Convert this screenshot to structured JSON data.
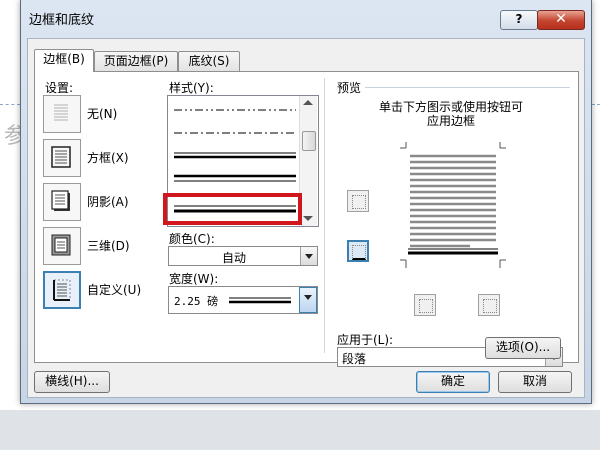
{
  "window": {
    "title": "边框和底纹",
    "help_label": "?",
    "close_label": "✕"
  },
  "tabs": [
    {
      "label": "边框(B)",
      "active": true
    },
    {
      "label": "页面边框(P)",
      "active": false
    },
    {
      "label": "底纹(S)",
      "active": false
    }
  ],
  "setting": {
    "label": "设置:",
    "presets": [
      {
        "label": "无(N)",
        "icon": "border-none-icon"
      },
      {
        "label": "方框(X)",
        "icon": "border-box-icon"
      },
      {
        "label": "阴影(A)",
        "icon": "border-shadow-icon"
      },
      {
        "label": "三维(D)",
        "icon": "border-3d-icon"
      },
      {
        "label": "自定义(U)",
        "icon": "border-custom-icon",
        "selected": true
      }
    ]
  },
  "style": {
    "label": "样式(Y):",
    "items": [
      "dash-dot-dot",
      "dash-dot",
      "thin-thick",
      "thick-thin",
      "double-thick"
    ],
    "selected_index": 4
  },
  "color": {
    "label": "颜色(C):",
    "value": "自动"
  },
  "width": {
    "label": "宽度(W):",
    "value": "2.25 磅"
  },
  "preview": {
    "label": "预览",
    "hint_line1": "单击下方图示或使用按钮可",
    "hint_line2": "应用边框"
  },
  "apply_to": {
    "label": "应用于(L):",
    "value": "段落"
  },
  "buttons": {
    "options": "选项(O)...",
    "horizontal_line": "横线(H)...",
    "ok": "确定",
    "cancel": "取消"
  },
  "doc_char": "参",
  "colors": {
    "accent": "#3c7fb1",
    "highlight": "#d2161e"
  }
}
